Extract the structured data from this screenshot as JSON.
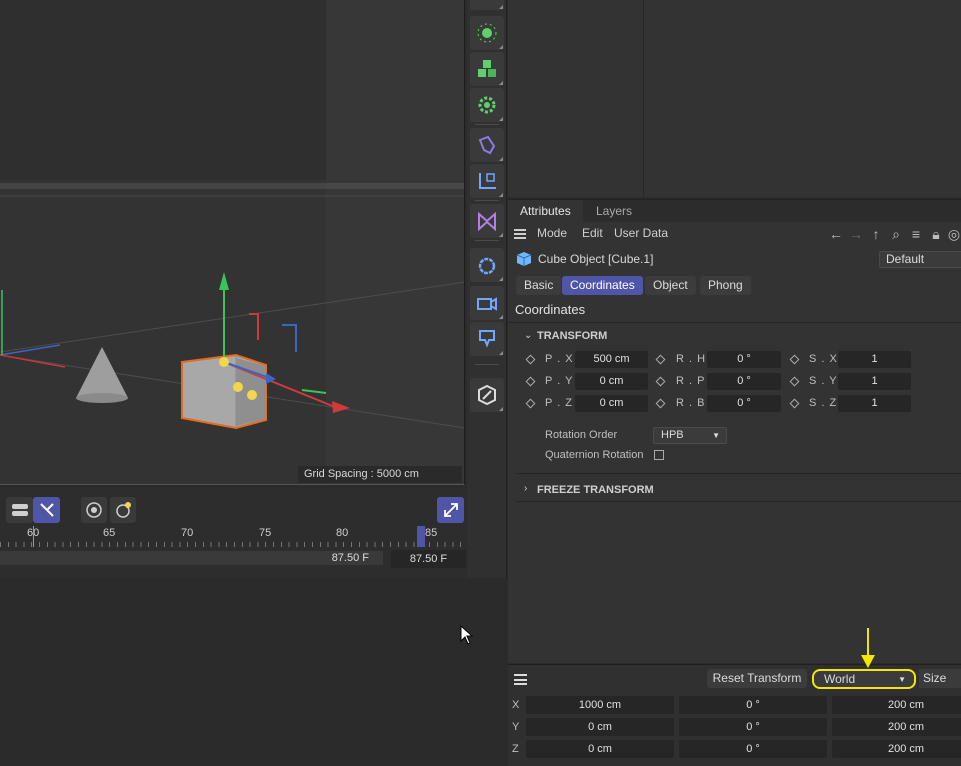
{
  "viewport": {
    "grid_spacing_label": "Grid Spacing : 5000 cm"
  },
  "attributes": {
    "tabs": [
      "Attributes",
      "Layers"
    ],
    "menu": [
      "Mode",
      "Edit",
      "User Data"
    ],
    "object_title": "Cube Object [Cube.1]",
    "layer_select": "Default",
    "sub_tabs": [
      "Basic",
      "Coordinates",
      "Object",
      "Phong"
    ],
    "active_sub_tab": "Coordinates",
    "section_title": "Coordinates",
    "transform_group": "TRANSFORM",
    "fields": {
      "px_label": "P . X",
      "px_value": "500 cm",
      "py_label": "P . Y",
      "py_value": "0 cm",
      "pz_label": "P . Z",
      "pz_value": "0 cm",
      "rh_label": "R . H",
      "rh_value": "0 °",
      "rp_label": "R . P",
      "rp_value": "0 °",
      "rb_label": "R . B",
      "rb_value": "0 °",
      "sx_label": "S . X",
      "sx_value": "1",
      "sy_label": "S . Y",
      "sy_value": "1",
      "sz_label": "S . Z",
      "sz_value": "1"
    },
    "rotation_order_label": "Rotation Order",
    "rotation_order_value": "HPB",
    "quaternion_label": "Quaternion Rotation",
    "quaternion_checked": false,
    "freeze_group": "FREEZE TRANSFORM"
  },
  "timeline": {
    "ticks": [
      "60",
      "65",
      "70",
      "75",
      "80",
      "85"
    ],
    "current_frame_bar": "87.50 F",
    "current_frame_box": "87.50 F"
  },
  "coord_manager": {
    "reset_label": "Reset Transform",
    "space_select": "World",
    "mode_select": "Size",
    "rows": [
      {
        "axis": "X",
        "position": "1000 cm",
        "rotation": "0 °",
        "size": "200 cm"
      },
      {
        "axis": "Y",
        "position": "0 cm",
        "rotation": "0 °",
        "size": "200 cm"
      },
      {
        "axis": "Z",
        "position": "0 cm",
        "rotation": "0 °",
        "size": "200 cm"
      }
    ]
  },
  "colors": {
    "accent": "#4f56a8",
    "highlight": "#f3e600",
    "toolbar_icon_green": "#5fd16a",
    "toolbar_icon_purple": "#b27fe8"
  },
  "icons": {
    "toolbar": [
      "light-icon",
      "cloner-icon",
      "effector-icon",
      "spline-pen-icon",
      "deformer-icon",
      "field-icon",
      "environment-icon",
      "camera-icon",
      "tag-icon",
      "edit-icon"
    ],
    "nav": [
      "back-arrow-icon",
      "forward-arrow-icon",
      "up-arrow-icon",
      "search-icon",
      "filter-icon",
      "lock-icon",
      "target-icon"
    ]
  }
}
